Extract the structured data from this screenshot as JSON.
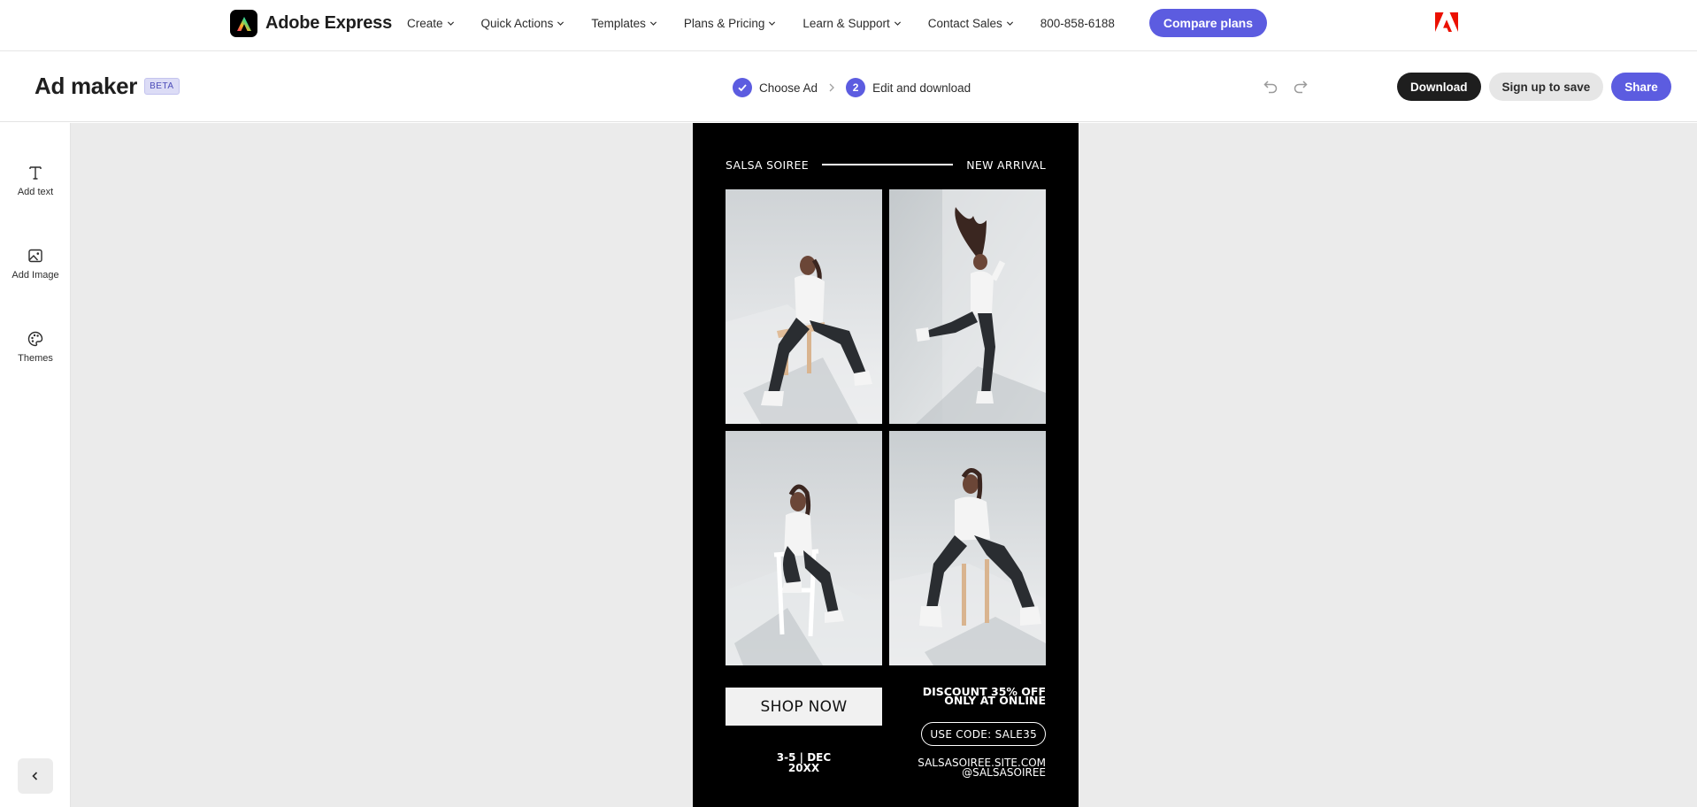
{
  "global_nav": {
    "brand": "Adobe Express",
    "items": [
      {
        "label": "Create",
        "icon": "chevron-down-icon"
      },
      {
        "label": "Quick Actions",
        "icon": "chevron-down-icon"
      },
      {
        "label": "Templates",
        "icon": "chevron-down-icon"
      },
      {
        "label": "Plans & Pricing",
        "icon": "chevron-down-icon"
      },
      {
        "label": "Learn & Support",
        "icon": "chevron-down-icon"
      },
      {
        "label": "Contact Sales",
        "icon": "chevron-down-icon"
      }
    ],
    "phone": "800-858-6188",
    "cta": "Compare plans",
    "accent_color": "#5c5ce0",
    "adobe_red": "#eb1000"
  },
  "app_header": {
    "title": "Ad maker",
    "badge": "BETA",
    "steps": [
      {
        "number": "",
        "label": "Choose Ad",
        "state": "complete"
      },
      {
        "number": "2",
        "label": "Edit and download",
        "state": "current"
      }
    ],
    "buttons": {
      "download": "Download",
      "signup": "Sign up to save",
      "share": "Share"
    }
  },
  "left_rail": {
    "items": [
      {
        "label": "Add text",
        "icon": "text-icon"
      },
      {
        "label": "Add Image",
        "icon": "image-icon"
      },
      {
        "label": "Themes",
        "icon": "palette-icon"
      }
    ],
    "collapse_icon": "chevron-left-icon"
  },
  "ad": {
    "brand_left": "SALSA SOIREE",
    "brand_right": "NEW ARRIVAL",
    "shop_button": "SHOP NOW",
    "dates": [
      "3-5 | DEC",
      "20XX"
    ],
    "discount": [
      "DISCOUNT 35% OFF",
      "ONLY AT ONLINE"
    ],
    "code": "USE CODE: SALE35",
    "contact": [
      "SALSASOIREE.SITE.COM",
      "@SALSASOIREE"
    ],
    "background_color": "#000000"
  }
}
